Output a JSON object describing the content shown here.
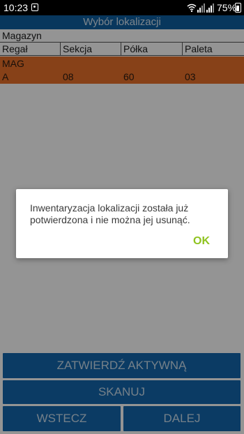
{
  "status_bar": {
    "time": "10:23",
    "battery": "75%"
  },
  "app": {
    "title": "Wybór lokalizacji",
    "warehouse_label": "Magazyn",
    "columns": [
      "Regał",
      "Sekcja",
      "Półka",
      "Paleta"
    ],
    "selected": {
      "warehouse": "MAG",
      "cells": [
        "A",
        "08",
        "60",
        "03"
      ]
    },
    "accent_color": "#e8702a",
    "title_bar_color": "#0f5fa0",
    "button_color": "#1366ac"
  },
  "buttons": {
    "confirm": "ZATWIERDŹ AKTYWNĄ INWENTARYZACJĘ",
    "scan": "SKANUJ",
    "back": "WSTECZ",
    "next": "DALEJ"
  },
  "dialog": {
    "message": "Inwentaryzacja lokalizacji została już potwierdzona i nie można jej usunąć.",
    "ok_label": "OK",
    "ok_color": "#8fc31f"
  },
  "icons": {
    "notification": "notification-icon",
    "wifi": "wifi-icon",
    "signal": "signal-icon",
    "battery": "battery-icon"
  }
}
